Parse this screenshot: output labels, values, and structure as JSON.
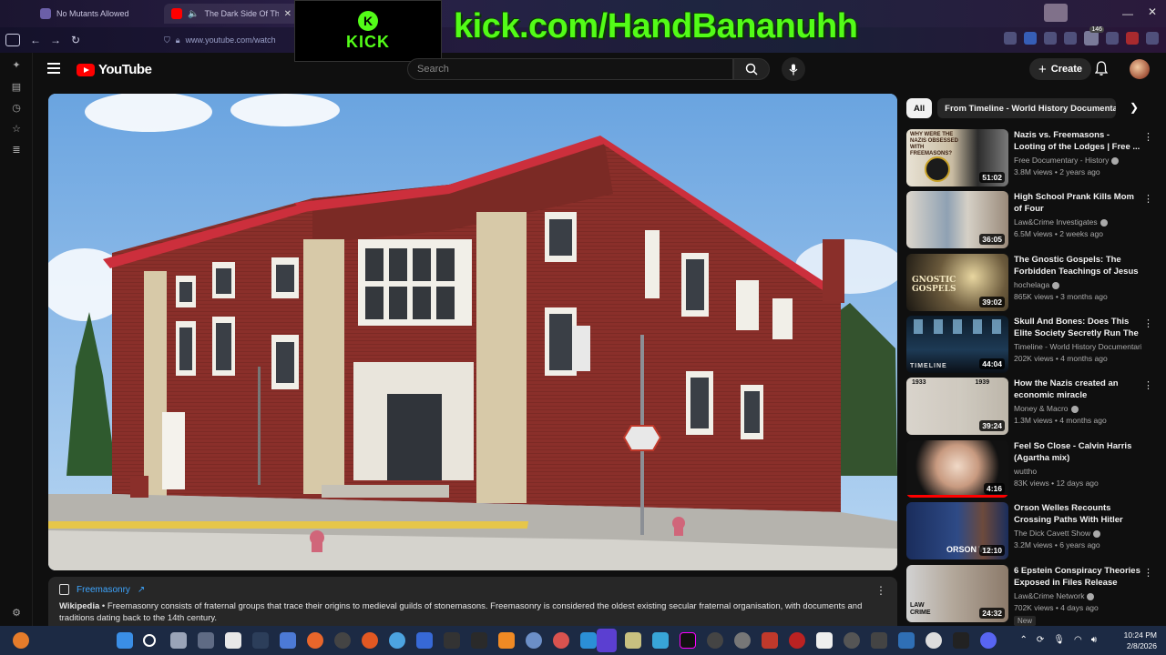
{
  "browser": {
    "tabs": [
      {
        "title": "No Mutants Allowed",
        "active": false
      },
      {
        "title": "The Dark Side Of The Free",
        "active": true
      }
    ],
    "url": "www.youtube.com/watch"
  },
  "overlay": {
    "kick_logo_mark": "K",
    "kick_logo_text": "KICK",
    "kick_url": "kick.com/HandBananuhh",
    "kick_green": "#53fc18"
  },
  "youtube": {
    "logo_text": "YouTube",
    "search_placeholder": "Search",
    "create_label": "Create",
    "brand_red": "#ff0000"
  },
  "info_card": {
    "topic": "Freemasonry",
    "topic_arrow": "↗",
    "source": "Wikipedia",
    "description": "Freemasonry consists of fraternal groups that trace their origins to medieval guilds of stonemasons. Freemasonry is considered the oldest existing secular fraternal organisation, with documents and traditions dating back to the 14th century."
  },
  "chips": [
    "All",
    "From Timeline - World History Documentaries"
  ],
  "recommendations": [
    {
      "title": "Nazis vs. Freemasons - Looting of the Lodges | Free ...",
      "channel": "Free Documentary - History",
      "verified": true,
      "meta": "3.8M views • 2 years ago",
      "duration": "51:02",
      "thumb_text": "WHY WERE THE NAZIS OBSESSED WITH FREEMASONS?"
    },
    {
      "title": "High School Prank Kills Mom of Four",
      "channel": "Law&Crime Investigates",
      "verified": true,
      "meta": "6.5M views • 2 weeks ago",
      "duration": "36:05",
      "thumb_text": ""
    },
    {
      "title": "The Gnostic Gospels: The Forbidden Teachings of Jesus",
      "channel": "hochelaga",
      "verified": true,
      "meta": "865K views • 3 months ago",
      "duration": "39:02",
      "thumb_text": "GNOSTIC GOSPELS"
    },
    {
      "title": "Skull And Bones: Does This Elite Society Secretly Run The ...",
      "channel": "Timeline - World History Documentaries",
      "verified": false,
      "meta": "202K views • 4 months ago",
      "duration": "44:04",
      "thumb_text": "TIMELINE"
    },
    {
      "title": "How the Nazis created an economic miracle",
      "channel": "Money & Macro",
      "verified": true,
      "meta": "1.3M views • 4 months ago",
      "duration": "39:24",
      "thumb_text": "1933 1939"
    },
    {
      "title": "Feel So Close - Calvin Harris (Agartha mix)",
      "channel": "wuttho",
      "verified": false,
      "meta": "83K views • 12 days ago",
      "duration": "4:16",
      "thumb_text": ""
    },
    {
      "title": "Orson Welles Recounts Crossing Paths With Hitler An...",
      "channel": "The Dick Cavett Show",
      "verified": true,
      "meta": "3.2M views • 6 years ago",
      "duration": "12:10",
      "thumb_text": "ORSON WE"
    },
    {
      "title": "6 Epstein Conspiracy Theories Exposed in Files Release",
      "channel": "Law&Crime Network",
      "verified": true,
      "meta": "702K views • 4 days ago",
      "duration": "24:32",
      "thumb_text": "LAW CRIME",
      "badge": "New"
    }
  ],
  "taskbar": {
    "time": "10:24 PM",
    "date": "2/8/2026",
    "badge_count": "146"
  }
}
